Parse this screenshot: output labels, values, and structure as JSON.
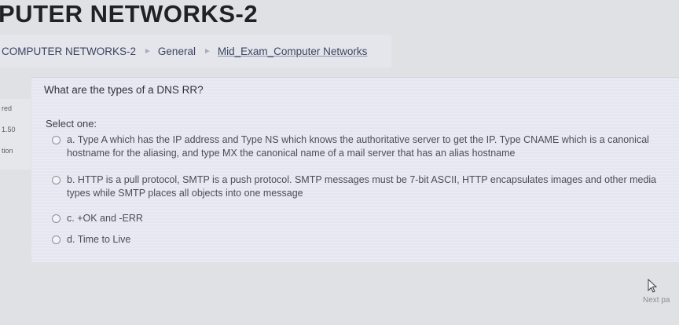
{
  "course_title": "PUTER NETWORKS-2",
  "breadcrumb": {
    "items": [
      "COMPUTER NETWORKS-2",
      "General",
      "Mid_Exam_Computer Networks"
    ],
    "separator": "►"
  },
  "info": {
    "status": "red",
    "marks": "1.50",
    "label": "tion"
  },
  "question": {
    "text": "What are the types of a DNS RR?",
    "select_one": "Select one:",
    "options": [
      {
        "letter": "a.",
        "text": "Type A which has the IP address and Type NS which knows the authoritative server to get the IP. Type CNAME which is a canonical hostname for the aliasing, and type MX the canonical name of a mail server that has an alias hostname"
      },
      {
        "letter": "b.",
        "text": "HTTP is a pull protocol, SMTP is a push protocol. SMTP messages must be 7-bit ASCII, HTTP encapsulates images and other media types while SMTP places all objects into one message"
      },
      {
        "letter": "c.",
        "text": "+OK and -ERR"
      },
      {
        "letter": "d.",
        "text": "Time to Live"
      }
    ]
  },
  "footer": {
    "next_label": "Next pa"
  }
}
